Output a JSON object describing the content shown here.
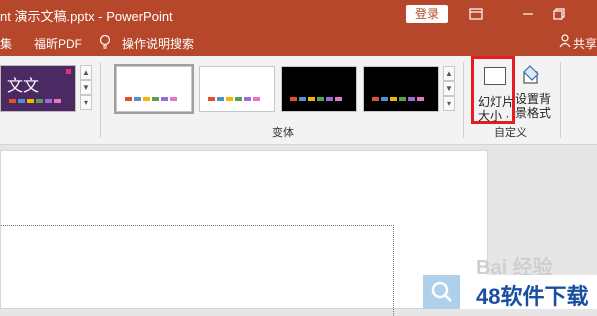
{
  "titlebar": {
    "title": "nt 演示文稿.pptx  -  PowerPoint",
    "login_label": "登录"
  },
  "menubar": {
    "items": [
      "集",
      "福昕PDF",
      "操作说明搜索"
    ],
    "share_label": "共享"
  },
  "ribbon": {
    "theme_thumb_text": "文文",
    "variants_group_label": "变体",
    "customize_group_label": "自定义",
    "slide_size": {
      "line1": "幻灯片",
      "line2": "大小 ·"
    },
    "bg_format": {
      "line1": "设置背",
      "line2": "景格式"
    }
  },
  "overlay": {
    "watermark": "Bai 经验",
    "brand_text": "48软件下载"
  },
  "colors": {
    "accent": "#b7472a",
    "highlight_box": "#e51c23",
    "palette": [
      "#e2502b",
      "#4f8fd6",
      "#f4b400",
      "#59a14f",
      "#9c6ade",
      "#e377c2"
    ]
  }
}
